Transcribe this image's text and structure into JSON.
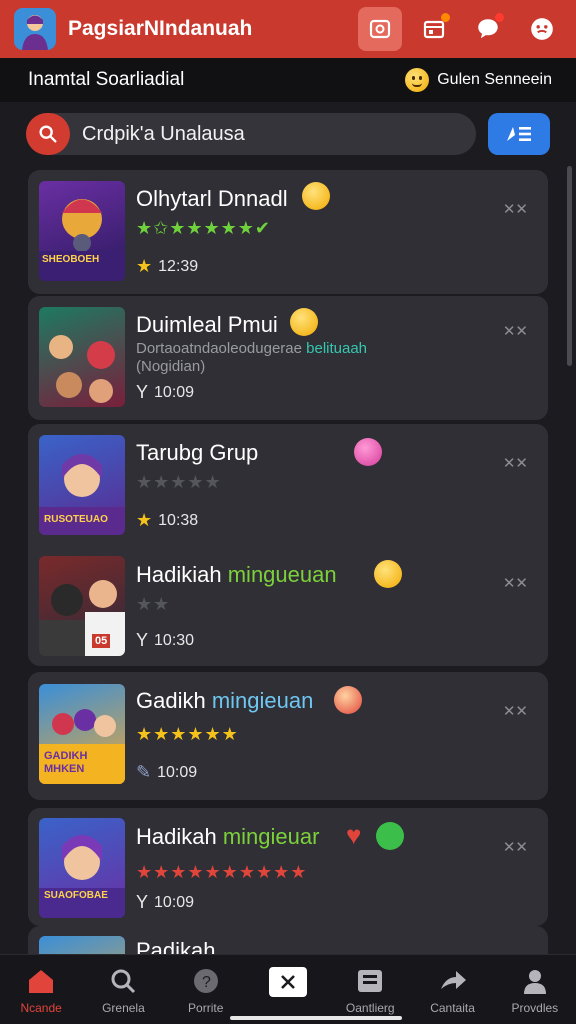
{
  "header": {
    "app_title": "PagsiarNIndanuah",
    "icons": [
      "camera-icon",
      "calendar-icon",
      "chat-icon",
      "face-icon"
    ]
  },
  "subheader": {
    "title": "Inamtal Soarliadial",
    "right_label": "Gulen Senneein"
  },
  "search": {
    "value": "Crdpik'a Unalausa"
  },
  "items": [
    {
      "title": "Olhytarl Dnnadl",
      "sub": "",
      "time": "12:39",
      "stars": "★✩★★★★★✔",
      "thumb_text": "SHEOBOEH"
    },
    {
      "title": "Duimleal Pmui",
      "sub": "Dortaoatndaoleodugerae",
      "sub_teal": "belituaah",
      "sub2": "(Nogidian)",
      "time": "10:09",
      "stars": "",
      "thumb_text": ""
    },
    {
      "title": "Tarubg Grup",
      "sub": "",
      "time": "10:38",
      "stars": "★★★★★",
      "thumb_text": "RUSOTEUAO"
    },
    {
      "title": "Hadikiah",
      "title_hl": "mingueuan",
      "sub": "",
      "time": "10:30",
      "stars": "★★",
      "thumb_text": "05"
    },
    {
      "title": "Gadikh",
      "title_hl": "mingieuan",
      "sub": "",
      "time": "10:09",
      "stars": "★★★★★★",
      "thumb_text": "GADIKH MHKEN"
    },
    {
      "title": "Hadikah",
      "title_hl": "mingieuar",
      "sub": "",
      "time": "10:09",
      "stars": "★★★★★★★★★★",
      "thumb_text": "SUAOFOBAE"
    },
    {
      "title": "Padikah",
      "sub": "",
      "time": "",
      "stars": "",
      "thumb_text": ""
    }
  ],
  "nav": [
    {
      "label": "Ncande",
      "icon": "home-icon"
    },
    {
      "label": "Grenela",
      "icon": "search-icon"
    },
    {
      "label": "Porrite",
      "icon": "explore-icon"
    },
    {
      "label": "",
      "icon": "close-icon"
    },
    {
      "label": "Oantlierg",
      "icon": "inbox-icon"
    },
    {
      "label": "Cantaita",
      "icon": "share-icon"
    },
    {
      "label": "Provdles",
      "icon": "profile-icon"
    }
  ],
  "colors": {
    "accent": "#c9392e",
    "bg": "#1c1c20",
    "card": "#2f2f35",
    "filter": "#2f7be6"
  }
}
